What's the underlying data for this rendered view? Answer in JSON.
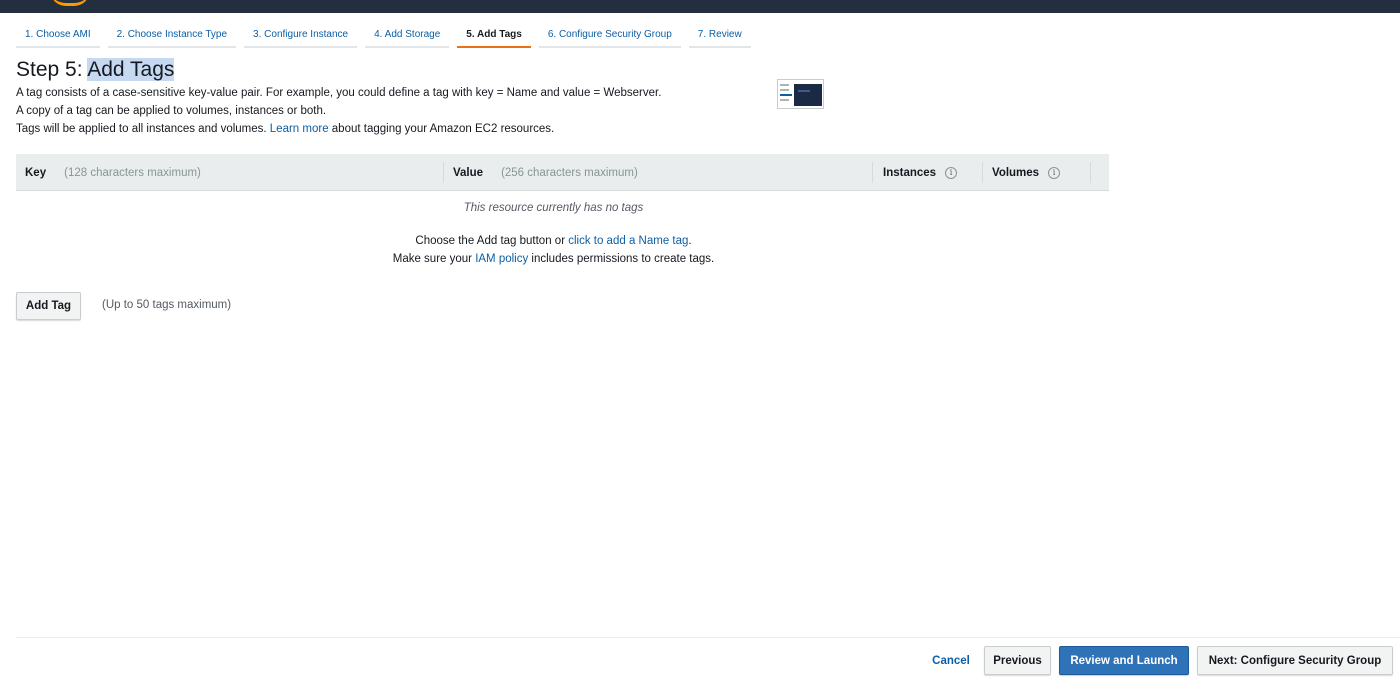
{
  "wizard": {
    "steps": [
      {
        "label": "1. Choose AMI"
      },
      {
        "label": "2. Choose Instance Type"
      },
      {
        "label": "3. Configure Instance"
      },
      {
        "label": "4. Add Storage"
      },
      {
        "label": "5. Add Tags",
        "active": true
      },
      {
        "label": "6. Configure Security Group"
      },
      {
        "label": "7. Review"
      }
    ]
  },
  "page": {
    "title_prefix": "Step 5: ",
    "title_highlight": "Add Tags",
    "desc_line1": "A tag consists of a case-sensitive key-value pair. For example, you could define a tag with key = Name and value = Webserver.",
    "desc_line2": "A copy of a tag can be applied to volumes, instances or both.",
    "desc_line3_before": "Tags will be applied to all instances and volumes. ",
    "desc_line3_link": "Learn more",
    "desc_line3_after": " about tagging your Amazon EC2 resources."
  },
  "table": {
    "key_label": "Key",
    "key_hint": "(128 characters maximum)",
    "value_label": "Value",
    "value_hint": "(256 characters maximum)",
    "instances_label": "Instances",
    "volumes_label": "Volumes",
    "info_glyph": "i",
    "empty_text": "This resource currently has no tags",
    "choose_before": "Choose the Add tag button or ",
    "choose_link": "click to add a Name tag",
    "choose_after": ".",
    "iam_before": "Make sure your ",
    "iam_link": "IAM policy",
    "iam_after": " includes permissions to create tags."
  },
  "actions": {
    "add_tag_label": "Add Tag",
    "add_tag_hint": "(Up to 50 tags maximum)"
  },
  "footer": {
    "cancel_label": "Cancel",
    "previous_label": "Previous",
    "review_label": "Review and Launch",
    "next_label": "Next: Configure Security Group"
  },
  "colors": {
    "nav_bg": "#232f3e",
    "accent_orange": "#ec7211",
    "link_blue": "#0b5fa5",
    "primary_button": "#2e73b8",
    "title_highlight": "#c7d9f1"
  }
}
